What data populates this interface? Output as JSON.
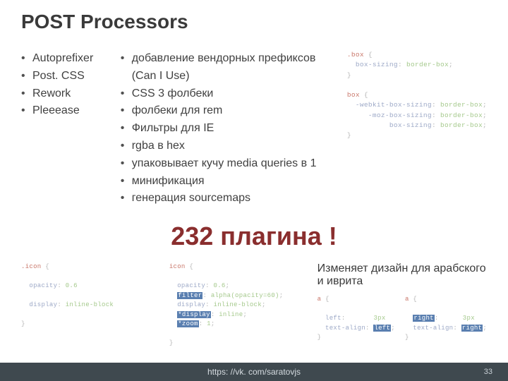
{
  "title": "POST Processors",
  "tools": [
    "Autoprefixer",
    "Post. CSS",
    "Rework",
    "Pleeease"
  ],
  "features": [
    "добавление вендорных префиксов (Can I Use)",
    "CSS 3 фолбеки",
    "фолбеки для rem",
    "Фильтры для IE",
    "rgba в hex",
    "упаковывает кучу media queries в 1",
    "минификация",
    "генерация sourcemaps"
  ],
  "code_right": {
    "block1_sel": ".box",
    "block1_prop": "box-sizing",
    "block1_val": "border-box",
    "block2_sel": "box",
    "block2_p1": "-webkit-box-sizing",
    "block2_v1": "border-box",
    "block2_p2": "-moz-box-sizing",
    "block2_v2": "border-box",
    "block2_p3": "box-sizing",
    "block2_v3": "border-box"
  },
  "bignote": "232 плагина !",
  "code_bl": {
    "sel": ".icon",
    "p1": "opacity",
    "v1": "0.6",
    "p2": "display",
    "v2": "inline-block"
  },
  "code_bm": {
    "sel": "icon",
    "p1": "opacity",
    "v1": "0.6",
    "p2": "filter",
    "v2": "alpha(opacity=60)",
    "p3": "display",
    "v3": "inline-block",
    "p4": "*display",
    "v4": "inline",
    "p5": "*zoom",
    "v5": "1"
  },
  "ar_note": "Изменяет дизайн для арабского и иврита",
  "code_ar1": {
    "sel": "a",
    "p1": "left",
    "v1": "3px",
    "p2": "text-align",
    "v2": "left"
  },
  "code_ar2": {
    "sel": "a",
    "p1": "right",
    "v1": "3px",
    "p2": "text-align",
    "v2": "right"
  },
  "footer_link": "https: //vk. com/saratovjs",
  "page_number": "33"
}
